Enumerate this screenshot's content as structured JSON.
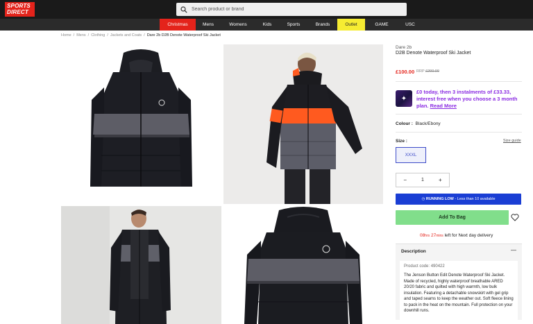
{
  "header": {
    "logo_line1": "SPORTS",
    "logo_line2": "DIRECT",
    "search_placeholder": "Search product or brand"
  },
  "nav": {
    "items": [
      {
        "label": "Christmas",
        "bg": "#e4231b",
        "color": "#ffffff"
      },
      {
        "label": "Mens"
      },
      {
        "label": "Womens"
      },
      {
        "label": "Kids"
      },
      {
        "label": "Sports"
      },
      {
        "label": "Brands"
      },
      {
        "label": "Outlet",
        "bg": "#f6ec32",
        "color": "#222222"
      },
      {
        "label": "GAME"
      },
      {
        "label": "USC"
      }
    ]
  },
  "breadcrumb": [
    "Home",
    "Mens",
    "Clothing",
    "Jackets and Coats",
    "Dare 2b D2B Denote Waterproof Ski Jacket"
  ],
  "product": {
    "brand": "Dare 2b",
    "name": "D2B Denote Waterproof Ski Jacket",
    "price": "£100.00",
    "rrp_label": "RRP",
    "rrp_value": "£200.00",
    "klarna_text": "£0 today, then 3 instalments of £33.33, interest free when you choose a 3 month plan.",
    "klarna_link": "Read More",
    "colour_label": "Colour :",
    "colour_value": "Black/Ebony",
    "size_label": "Size :",
    "size_guide": "Size guide",
    "size_selected": "XXXL",
    "qty_minus": "−",
    "qty_value": "1",
    "qty_plus": "+",
    "running_low_title": "RUNNING LOW",
    "running_low_text": "- Less than 10 available",
    "add_to_bag": "Add To Bag",
    "delivery_hours": "08",
    "delivery_hrs_label": "hrs",
    "delivery_minutes": "27",
    "delivery_mins_label": "mins",
    "delivery_text": "left for Next day delivery"
  },
  "description": {
    "title": "Description",
    "toggle": "—",
    "product_code": "Product code: 490422",
    "text": "The Jenson Button Edit Denote Waterproof Ski Jacket. Made of recycled, highly waterproof breathable ARED 20/20 fabric and quilted with high warmth, low bulk insulation. Featuring a detachable snowskirt with gel grip and taped seams to keep the weather out. Soft fleece lining to pack in the heat on the mountain. Full protection on your downhill runs."
  },
  "colors": {
    "brand_red": "#e4231b",
    "accent_blue": "#1a3ed4",
    "add_to_bag_green": "#81de8b",
    "klarna_purple": "#8a2be2"
  }
}
